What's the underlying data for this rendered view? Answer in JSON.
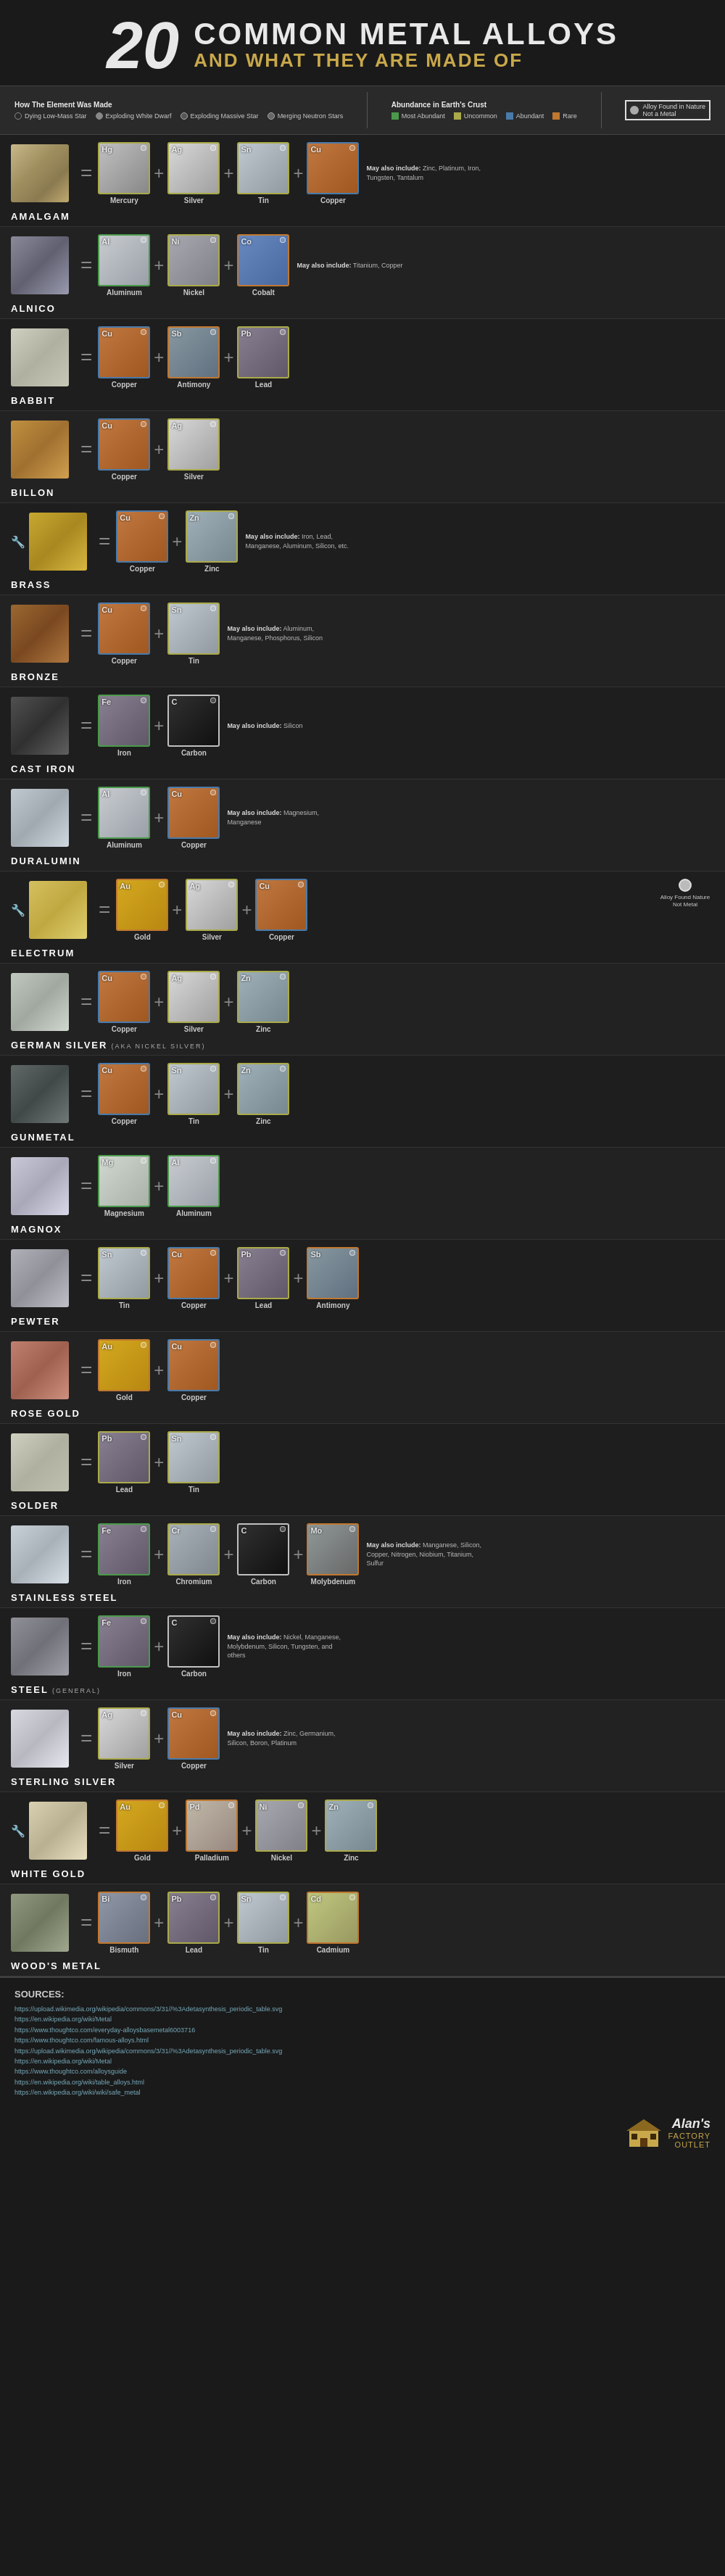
{
  "header": {
    "number": "20",
    "line1": "COMMON METAL ALLOYS",
    "line2": "AND WHAT THEY ARE MADE OF"
  },
  "legend": {
    "how_title": "How The Element Was Made",
    "how_items": [
      {
        "label": "Dying Low-Mass Star",
        "type": "circle-empty"
      },
      {
        "label": "Exploding White Dwarf",
        "type": "circle-half"
      },
      {
        "label": "Exploding Massive Star",
        "type": "circle-dark"
      },
      {
        "label": "Merging Neutron Stars",
        "type": "circle-outline"
      }
    ],
    "abundance_title": "Abundance in Earth's Crust",
    "abundance_items": [
      {
        "label": "Most Abundant",
        "color": "#4a9a4a"
      },
      {
        "label": "Uncommon",
        "color": "#aaaa4a"
      },
      {
        "label": "Abundant",
        "color": "#4a7aaa"
      },
      {
        "label": "Rare",
        "color": "#c07830"
      }
    ],
    "alloy_found": "Alloy Found in Nature",
    "not_metal": "Not a Metal"
  },
  "alloys": [
    {
      "name": "AMALGAM",
      "sub": "",
      "img_class": "alloy-amalgam",
      "has_wrench": false,
      "found_in_nature": false,
      "components": [
        {
          "symbol": "Hg",
          "name": "Mercury",
          "el_class": "el-mercury",
          "border": "border-uncommon"
        },
        {
          "symbol": "Ag",
          "name": "Silver",
          "el_class": "el-silver",
          "border": "border-uncommon"
        },
        {
          "symbol": "Sn",
          "name": "Tin",
          "el_class": "el-tin",
          "border": "border-uncommon"
        },
        {
          "symbol": "Cu",
          "name": "Copper",
          "el_class": "el-copper",
          "border": "border-abundant"
        }
      ],
      "may_also": "May also include: Zinc, Platinum, Iron, Tungsten, Tantalum"
    },
    {
      "name": "ALNICO",
      "sub": "",
      "img_class": "alloy-alnico",
      "has_wrench": false,
      "found_in_nature": false,
      "components": [
        {
          "symbol": "Al",
          "name": "Aluminum",
          "el_class": "el-aluminum",
          "border": "border-most-abundant"
        },
        {
          "symbol": "Ni",
          "name": "Nickel",
          "el_class": "el-nickel",
          "border": "border-uncommon"
        },
        {
          "symbol": "Co",
          "name": "Cobalt",
          "el_class": "el-cobalt",
          "border": "border-rare"
        }
      ],
      "may_also": "May also include: Titanium, Copper"
    },
    {
      "name": "BABBIT",
      "sub": "",
      "img_class": "alloy-babbit",
      "has_wrench": false,
      "found_in_nature": false,
      "components": [
        {
          "symbol": "Cu",
          "name": "Copper",
          "el_class": "el-copper",
          "border": "border-abundant"
        },
        {
          "symbol": "Sb",
          "name": "Antimony",
          "el_class": "el-antimony",
          "border": "border-rare"
        },
        {
          "symbol": "Pb",
          "name": "Lead",
          "el_class": "el-lead",
          "border": "border-uncommon"
        }
      ],
      "may_also": ""
    },
    {
      "name": "BILLON",
      "sub": "",
      "img_class": "alloy-billon",
      "has_wrench": false,
      "found_in_nature": false,
      "components": [
        {
          "symbol": "Cu",
          "name": "Copper",
          "el_class": "el-copper",
          "border": "border-abundant"
        },
        {
          "symbol": "Ag",
          "name": "Silver",
          "el_class": "el-silver",
          "border": "border-uncommon"
        }
      ],
      "may_also": ""
    },
    {
      "name": "BRASS",
      "sub": "",
      "img_class": "alloy-brass",
      "has_wrench": true,
      "found_in_nature": false,
      "components": [
        {
          "symbol": "Cu",
          "name": "Copper",
          "el_class": "el-copper",
          "border": "border-abundant"
        },
        {
          "symbol": "Zn",
          "name": "Zinc",
          "el_class": "el-zinc",
          "border": "border-uncommon"
        }
      ],
      "may_also": "May also include: Iron, Lead, Manganese, Aluminum, Silicon, etc."
    },
    {
      "name": "BRONZE",
      "sub": "",
      "img_class": "alloy-bronze",
      "has_wrench": false,
      "found_in_nature": false,
      "components": [
        {
          "symbol": "Cu",
          "name": "Copper",
          "el_class": "el-copper",
          "border": "border-abundant"
        },
        {
          "symbol": "Sn",
          "name": "Tin",
          "el_class": "el-tin",
          "border": "border-uncommon"
        }
      ],
      "may_also": "May also include: Aluminum, Manganese, Phosphorus, Silicon"
    },
    {
      "name": "CAST IRON",
      "sub": "",
      "img_class": "alloy-castiron",
      "has_wrench": false,
      "found_in_nature": false,
      "components": [
        {
          "symbol": "Fe",
          "name": "Iron",
          "el_class": "el-iron",
          "border": "border-most-abundant"
        },
        {
          "symbol": "C",
          "name": "Carbon",
          "el_class": "el-carbon",
          "border": "border-not-metal"
        }
      ],
      "may_also": "May also include: Silicon"
    },
    {
      "name": "DURALUMIN",
      "sub": "",
      "img_class": "alloy-duralumin",
      "has_wrench": false,
      "found_in_nature": false,
      "components": [
        {
          "symbol": "Al",
          "name": "Aluminum",
          "el_class": "el-aluminum",
          "border": "border-most-abundant"
        },
        {
          "symbol": "Cu",
          "name": "Copper",
          "el_class": "el-copper",
          "border": "border-abundant"
        }
      ],
      "may_also": "May also include: Magnesium, Manganese"
    },
    {
      "name": "ELECTRUM",
      "sub": "",
      "img_class": "alloy-electrum",
      "has_wrench": true,
      "found_in_nature": true,
      "components": [
        {
          "symbol": "Au",
          "name": "Gold",
          "el_class": "el-gold",
          "border": "border-rare"
        },
        {
          "symbol": "Ag",
          "name": "Silver",
          "el_class": "el-silver",
          "border": "border-uncommon"
        },
        {
          "symbol": "Cu",
          "name": "Copper",
          "el_class": "el-copper",
          "border": "border-abundant"
        }
      ],
      "may_also": ""
    },
    {
      "name": "GERMAN SILVER",
      "sub": "(AKA NICKEL SILVER)",
      "img_class": "alloy-germsilver",
      "has_wrench": false,
      "found_in_nature": false,
      "components": [
        {
          "symbol": "Cu",
          "name": "Copper",
          "el_class": "el-copper",
          "border": "border-abundant"
        },
        {
          "symbol": "Ag",
          "name": "Silver",
          "el_class": "el-silver",
          "border": "border-uncommon"
        },
        {
          "symbol": "Zn",
          "name": "Zinc",
          "el_class": "el-zinc",
          "border": "border-uncommon"
        }
      ],
      "may_also": ""
    },
    {
      "name": "GUNMETAL",
      "sub": "",
      "img_class": "alloy-gunmetal",
      "has_wrench": false,
      "found_in_nature": false,
      "components": [
        {
          "symbol": "Cu",
          "name": "Copper",
          "el_class": "el-copper",
          "border": "border-abundant"
        },
        {
          "symbol": "Sn",
          "name": "Tin",
          "el_class": "el-tin",
          "border": "border-uncommon"
        },
        {
          "symbol": "Zn",
          "name": "Zinc",
          "el_class": "el-zinc",
          "border": "border-uncommon"
        }
      ],
      "may_also": ""
    },
    {
      "name": "MAGNOX",
      "sub": "",
      "img_class": "alloy-magnox",
      "has_wrench": false,
      "found_in_nature": false,
      "components": [
        {
          "symbol": "Mg",
          "name": "Magnesium",
          "el_class": "el-magnesium",
          "border": "border-most-abundant"
        },
        {
          "symbol": "Al",
          "name": "Aluminum",
          "el_class": "el-aluminum",
          "border": "border-most-abundant"
        }
      ],
      "may_also": ""
    },
    {
      "name": "PEWTER",
      "sub": "",
      "img_class": "alloy-pewter",
      "has_wrench": false,
      "found_in_nature": false,
      "components": [
        {
          "symbol": "Sn",
          "name": "Tin",
          "el_class": "el-tin",
          "border": "border-uncommon"
        },
        {
          "symbol": "Cu",
          "name": "Copper",
          "el_class": "el-copper",
          "border": "border-abundant"
        },
        {
          "symbol": "Pb",
          "name": "Lead",
          "el_class": "el-lead",
          "border": "border-uncommon"
        },
        {
          "symbol": "Sb",
          "name": "Antimony",
          "el_class": "el-antimony",
          "border": "border-rare"
        }
      ],
      "may_also": ""
    },
    {
      "name": "ROSE GOLD",
      "sub": "",
      "img_class": "alloy-rosegold",
      "has_wrench": false,
      "found_in_nature": false,
      "components": [
        {
          "symbol": "Au",
          "name": "Gold",
          "el_class": "el-gold",
          "border": "border-rare"
        },
        {
          "symbol": "Cu",
          "name": "Copper",
          "el_class": "el-copper",
          "border": "border-abundant"
        }
      ],
      "may_also": ""
    },
    {
      "name": "SOLDER",
      "sub": "",
      "img_class": "alloy-solder",
      "has_wrench": false,
      "found_in_nature": false,
      "components": [
        {
          "symbol": "Pb",
          "name": "Lead",
          "el_class": "el-lead",
          "border": "border-uncommon"
        },
        {
          "symbol": "Sn",
          "name": "Tin",
          "el_class": "el-tin",
          "border": "border-uncommon"
        }
      ],
      "may_also": ""
    },
    {
      "name": "STAINLESS STEEL",
      "sub": "",
      "img_class": "alloy-stainless",
      "has_wrench": false,
      "found_in_nature": false,
      "components": [
        {
          "symbol": "Fe",
          "name": "Iron",
          "el_class": "el-iron",
          "border": "border-most-abundant"
        },
        {
          "symbol": "Cr",
          "name": "Chromium",
          "el_class": "el-chromium",
          "border": "border-uncommon"
        },
        {
          "symbol": "C",
          "name": "Carbon",
          "el_class": "el-carbon",
          "border": "border-not-metal"
        },
        {
          "symbol": "Mo",
          "name": "Molybdenum",
          "el_class": "el-molybdenum",
          "border": "border-rare"
        }
      ],
      "may_also": "May also include: Manganese, Silicon, Copper, Nitrogen, Niobium, Titanium, Sulfur"
    },
    {
      "name": "STEEL",
      "sub": "(GENERAL)",
      "img_class": "alloy-steel",
      "has_wrench": false,
      "found_in_nature": false,
      "components": [
        {
          "symbol": "Fe",
          "name": "Iron",
          "el_class": "el-iron",
          "border": "border-most-abundant"
        },
        {
          "symbol": "C",
          "name": "Carbon",
          "el_class": "el-carbon",
          "border": "border-not-metal"
        }
      ],
      "may_also": "May also include: Nickel, Manganese, Molybdenum, Silicon, Tungsten, and others"
    },
    {
      "name": "STERLING SILVER",
      "sub": "",
      "img_class": "alloy-sterling",
      "has_wrench": false,
      "found_in_nature": false,
      "components": [
        {
          "symbol": "Ag",
          "name": "Silver",
          "el_class": "el-silver",
          "border": "border-uncommon"
        },
        {
          "symbol": "Cu",
          "name": "Copper",
          "el_class": "el-copper",
          "border": "border-abundant"
        }
      ],
      "may_also": "May also include: Zinc, Germanium, Silicon, Boron, Platinum"
    },
    {
      "name": "WHITE GOLD",
      "sub": "",
      "img_class": "alloy-whitegold",
      "has_wrench": true,
      "found_in_nature": false,
      "components": [
        {
          "symbol": "Au",
          "name": "Gold",
          "el_class": "el-gold",
          "border": "border-rare"
        },
        {
          "symbol": "Pd",
          "name": "Palladium",
          "el_class": "el-palladium",
          "border": "border-rare"
        },
        {
          "symbol": "Ni",
          "name": "Nickel",
          "el_class": "el-nickel",
          "border": "border-uncommon"
        },
        {
          "symbol": "Zn",
          "name": "Zinc",
          "el_class": "el-zinc",
          "border": "border-uncommon"
        }
      ],
      "may_also": ""
    },
    {
      "name": "WOOD'S METAL",
      "sub": "",
      "img_class": "alloy-woodsmetal",
      "has_wrench": false,
      "found_in_nature": false,
      "components": [
        {
          "symbol": "Bi",
          "name": "Bismuth",
          "el_class": "el-bismuth",
          "border": "border-rare"
        },
        {
          "symbol": "Pb",
          "name": "Lead",
          "el_class": "el-lead",
          "border": "border-uncommon"
        },
        {
          "symbol": "Sn",
          "name": "Tin",
          "el_class": "el-tin",
          "border": "border-uncommon"
        },
        {
          "symbol": "Cd",
          "name": "Cadmium",
          "el_class": "el-cadmium",
          "border": "border-rare"
        }
      ],
      "may_also": ""
    }
  ],
  "sources": {
    "title": "SOURCES:",
    "links": [
      "https://upload.wikimedia.org/wikipedia/commons/3/31//%3Adetasynthesis_periodic_table.svg",
      "https://en.wikipedia.org/wiki/Metal",
      "https://www.thoughtco.com/everyday-alloysbasemetal6003716",
      "https://www.thoughtco.com/famous-alloys.html",
      "https://upload.wikimedia.org/wikipedia/commons/3/31//%3Adetasynthesis_periodic_table.svg",
      "https://en.wikipedia.org/wiki/Metal",
      "https://www.thoughtco.com/alloysguide",
      "https://en.wikipedia.org/wiki/table_alloys.html",
      "https://en.wikipedia.org/wiki/wiki/safe_metal"
    ]
  },
  "footer": {
    "brand": "Alan's",
    "line1": "Factory",
    "line2": "Outlet"
  }
}
